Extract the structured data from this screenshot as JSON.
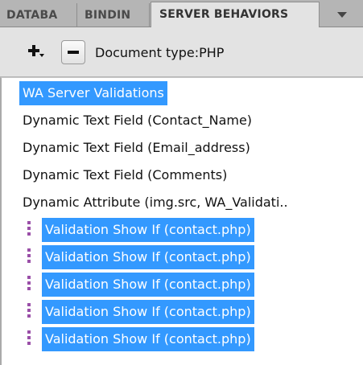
{
  "tabs": [
    {
      "label": "DATABA",
      "active": false
    },
    {
      "label": "BINDIN",
      "active": false
    },
    {
      "label": "SERVER BEHAVIORS",
      "active": true
    }
  ],
  "toolbar": {
    "add_icon": "plus-dropdown-icon",
    "remove_icon": "minus-icon",
    "doc_type_label": "Document type:PHP"
  },
  "behaviors": [
    {
      "label": "WA Server Validations",
      "selected": true,
      "marker": false
    },
    {
      "label": "Dynamic Text Field (Contact_Name)",
      "selected": false,
      "marker": false
    },
    {
      "label": "Dynamic Text Field (Email_address)",
      "selected": false,
      "marker": false
    },
    {
      "label": "Dynamic Text Field (Comments)",
      "selected": false,
      "marker": false
    },
    {
      "label": "Dynamic Attribute (img.src, WA_Validati..",
      "selected": false,
      "marker": false
    },
    {
      "label": "Validation Show If (contact.php)",
      "selected": true,
      "marker": true
    },
    {
      "label": "Validation Show If (contact.php)",
      "selected": true,
      "marker": true
    },
    {
      "label": "Validation Show If (contact.php)",
      "selected": true,
      "marker": true
    },
    {
      "label": "Validation Show If (contact.php)",
      "selected": true,
      "marker": true
    },
    {
      "label": "Validation Show If (contact.php)",
      "selected": true,
      "marker": true
    }
  ],
  "colors": {
    "selection": "#3399ff",
    "marker": "#9a4fa8"
  }
}
